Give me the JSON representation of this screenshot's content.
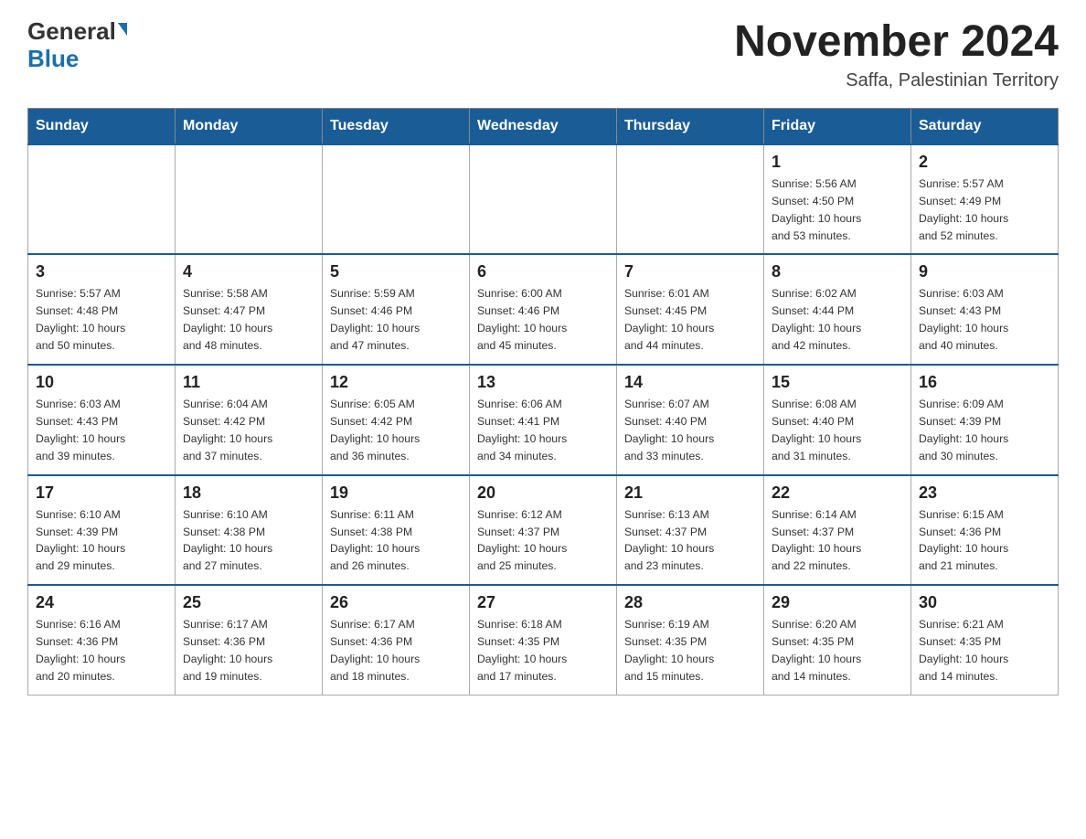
{
  "header": {
    "logo_general": "General",
    "logo_blue": "Blue",
    "title": "November 2024",
    "subtitle": "Saffa, Palestinian Territory"
  },
  "weekdays": [
    "Sunday",
    "Monday",
    "Tuesday",
    "Wednesday",
    "Thursday",
    "Friday",
    "Saturday"
  ],
  "weeks": [
    [
      {
        "day": "",
        "info": ""
      },
      {
        "day": "",
        "info": ""
      },
      {
        "day": "",
        "info": ""
      },
      {
        "day": "",
        "info": ""
      },
      {
        "day": "",
        "info": ""
      },
      {
        "day": "1",
        "info": "Sunrise: 5:56 AM\nSunset: 4:50 PM\nDaylight: 10 hours\nand 53 minutes."
      },
      {
        "day": "2",
        "info": "Sunrise: 5:57 AM\nSunset: 4:49 PM\nDaylight: 10 hours\nand 52 minutes."
      }
    ],
    [
      {
        "day": "3",
        "info": "Sunrise: 5:57 AM\nSunset: 4:48 PM\nDaylight: 10 hours\nand 50 minutes."
      },
      {
        "day": "4",
        "info": "Sunrise: 5:58 AM\nSunset: 4:47 PM\nDaylight: 10 hours\nand 48 minutes."
      },
      {
        "day": "5",
        "info": "Sunrise: 5:59 AM\nSunset: 4:46 PM\nDaylight: 10 hours\nand 47 minutes."
      },
      {
        "day": "6",
        "info": "Sunrise: 6:00 AM\nSunset: 4:46 PM\nDaylight: 10 hours\nand 45 minutes."
      },
      {
        "day": "7",
        "info": "Sunrise: 6:01 AM\nSunset: 4:45 PM\nDaylight: 10 hours\nand 44 minutes."
      },
      {
        "day": "8",
        "info": "Sunrise: 6:02 AM\nSunset: 4:44 PM\nDaylight: 10 hours\nand 42 minutes."
      },
      {
        "day": "9",
        "info": "Sunrise: 6:03 AM\nSunset: 4:43 PM\nDaylight: 10 hours\nand 40 minutes."
      }
    ],
    [
      {
        "day": "10",
        "info": "Sunrise: 6:03 AM\nSunset: 4:43 PM\nDaylight: 10 hours\nand 39 minutes."
      },
      {
        "day": "11",
        "info": "Sunrise: 6:04 AM\nSunset: 4:42 PM\nDaylight: 10 hours\nand 37 minutes."
      },
      {
        "day": "12",
        "info": "Sunrise: 6:05 AM\nSunset: 4:42 PM\nDaylight: 10 hours\nand 36 minutes."
      },
      {
        "day": "13",
        "info": "Sunrise: 6:06 AM\nSunset: 4:41 PM\nDaylight: 10 hours\nand 34 minutes."
      },
      {
        "day": "14",
        "info": "Sunrise: 6:07 AM\nSunset: 4:40 PM\nDaylight: 10 hours\nand 33 minutes."
      },
      {
        "day": "15",
        "info": "Sunrise: 6:08 AM\nSunset: 4:40 PM\nDaylight: 10 hours\nand 31 minutes."
      },
      {
        "day": "16",
        "info": "Sunrise: 6:09 AM\nSunset: 4:39 PM\nDaylight: 10 hours\nand 30 minutes."
      }
    ],
    [
      {
        "day": "17",
        "info": "Sunrise: 6:10 AM\nSunset: 4:39 PM\nDaylight: 10 hours\nand 29 minutes."
      },
      {
        "day": "18",
        "info": "Sunrise: 6:10 AM\nSunset: 4:38 PM\nDaylight: 10 hours\nand 27 minutes."
      },
      {
        "day": "19",
        "info": "Sunrise: 6:11 AM\nSunset: 4:38 PM\nDaylight: 10 hours\nand 26 minutes."
      },
      {
        "day": "20",
        "info": "Sunrise: 6:12 AM\nSunset: 4:37 PM\nDaylight: 10 hours\nand 25 minutes."
      },
      {
        "day": "21",
        "info": "Sunrise: 6:13 AM\nSunset: 4:37 PM\nDaylight: 10 hours\nand 23 minutes."
      },
      {
        "day": "22",
        "info": "Sunrise: 6:14 AM\nSunset: 4:37 PM\nDaylight: 10 hours\nand 22 minutes."
      },
      {
        "day": "23",
        "info": "Sunrise: 6:15 AM\nSunset: 4:36 PM\nDaylight: 10 hours\nand 21 minutes."
      }
    ],
    [
      {
        "day": "24",
        "info": "Sunrise: 6:16 AM\nSunset: 4:36 PM\nDaylight: 10 hours\nand 20 minutes."
      },
      {
        "day": "25",
        "info": "Sunrise: 6:17 AM\nSunset: 4:36 PM\nDaylight: 10 hours\nand 19 minutes."
      },
      {
        "day": "26",
        "info": "Sunrise: 6:17 AM\nSunset: 4:36 PM\nDaylight: 10 hours\nand 18 minutes."
      },
      {
        "day": "27",
        "info": "Sunrise: 6:18 AM\nSunset: 4:35 PM\nDaylight: 10 hours\nand 17 minutes."
      },
      {
        "day": "28",
        "info": "Sunrise: 6:19 AM\nSunset: 4:35 PM\nDaylight: 10 hours\nand 15 minutes."
      },
      {
        "day": "29",
        "info": "Sunrise: 6:20 AM\nSunset: 4:35 PM\nDaylight: 10 hours\nand 14 minutes."
      },
      {
        "day": "30",
        "info": "Sunrise: 6:21 AM\nSunset: 4:35 PM\nDaylight: 10 hours\nand 14 minutes."
      }
    ]
  ]
}
